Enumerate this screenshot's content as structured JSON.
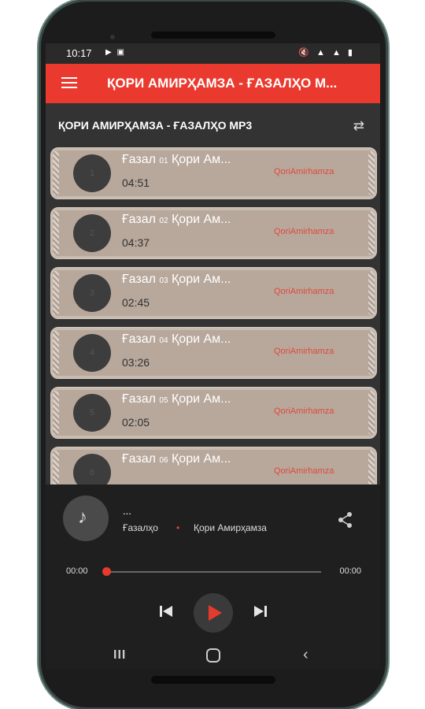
{
  "status": {
    "time": "10:17",
    "left_icons": "▶ ▣",
    "right_icons": "🔇 ▲ ▲ ▮"
  },
  "appbar": {
    "title": "ҚОРИ АМИРҲАМЗА - ҒАЗАЛҲО М..."
  },
  "playlist": {
    "title": "ҚОРИ АМИРҲАМЗА - ҒАЗАЛҲО MP3"
  },
  "tracks": [
    {
      "num": "1",
      "prefix": "Ғазал",
      "index": "01",
      "rest": "Қори Ам...",
      "duration": "04:51",
      "artist": "QoriAmirhamza"
    },
    {
      "num": "2",
      "prefix": "Ғазал",
      "index": "02",
      "rest": "Қори Ам...",
      "duration": "04:37",
      "artist": "QoriAmirhamza"
    },
    {
      "num": "3",
      "prefix": "Ғазал",
      "index": "03",
      "rest": "Қори Ам...",
      "duration": "02:45",
      "artist": "QoriAmirhamza"
    },
    {
      "num": "4",
      "prefix": "Ғазал",
      "index": "04",
      "rest": "Қори Ам...",
      "duration": "03:26",
      "artist": "QoriAmirhamza"
    },
    {
      "num": "5",
      "prefix": "Ғазал",
      "index": "05",
      "rest": "Қори Ам...",
      "duration": "02:05",
      "artist": "QoriAmirhamza"
    },
    {
      "num": "6",
      "prefix": "Ғазал",
      "index": "06",
      "rest": "Қори Ам...",
      "duration": "",
      "artist": "QoriAmirhamza"
    }
  ],
  "player": {
    "title": "...",
    "album": "Ғазалҳо",
    "separator": "•",
    "artist": "Қори Амирҳамза",
    "time_start": "00:00",
    "time_end": "00:00",
    "progress": 0
  },
  "colors": {
    "accent": "#ea3a2f",
    "card": "#b8a89c",
    "background": "#333333",
    "player": "#1f1f1f"
  },
  "icons": {
    "menu": "hamburger-icon",
    "repeat": "repeat-icon",
    "share": "share-icon",
    "music": "music-note-icon"
  }
}
